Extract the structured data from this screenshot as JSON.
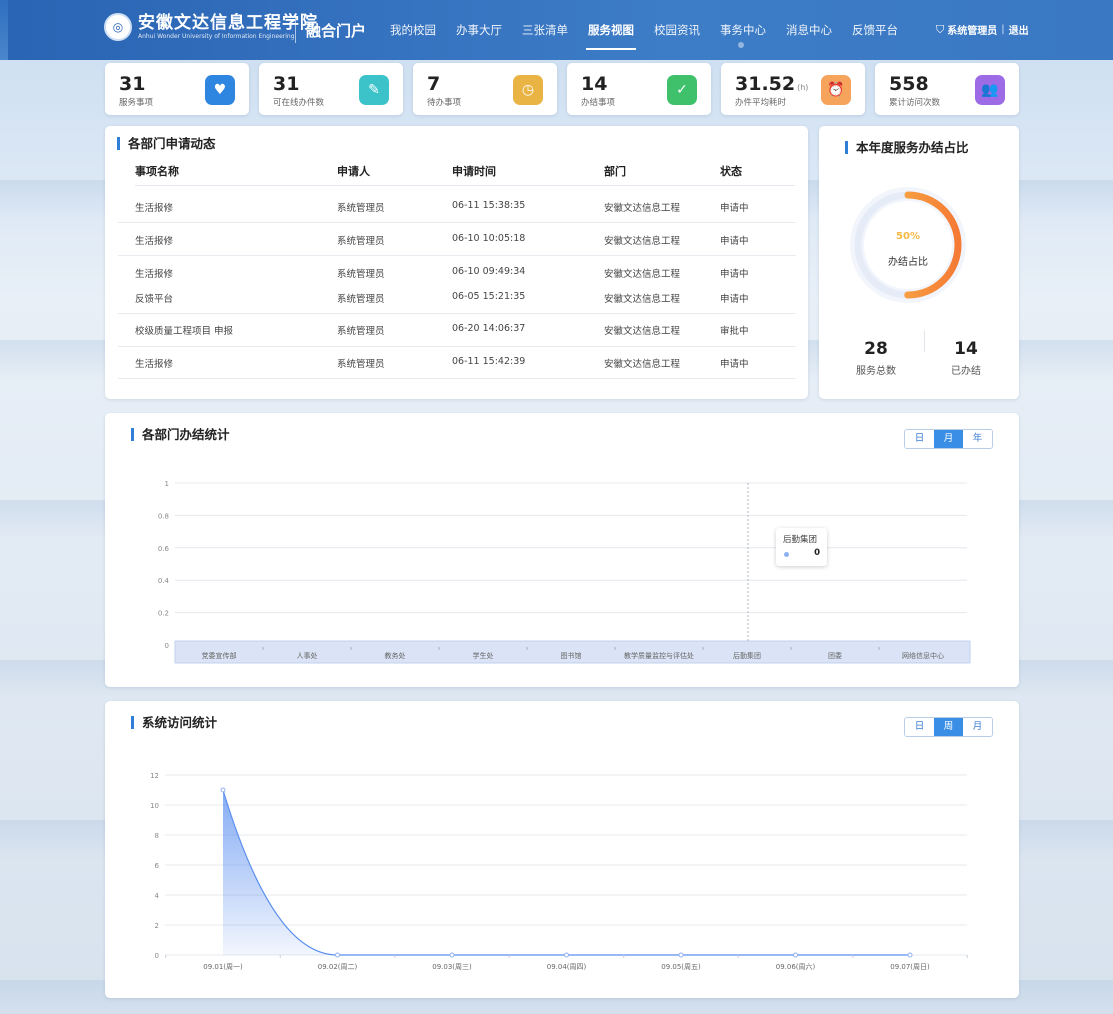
{
  "header": {
    "logo_cn": "安徽文达信息工程学院",
    "logo_en": "Anhui Wonder University of Information Engineering",
    "portal_title": "融合门户",
    "nav": [
      "我的校园",
      "办事大厅",
      "三张清单",
      "服务视图",
      "校园资讯",
      "事务中心",
      "消息中心",
      "反馈平台"
    ],
    "active_nav": "服务视图",
    "user": "系统管理员",
    "separator": "|",
    "logout": "退出"
  },
  "stats": [
    {
      "value": "31",
      "unit": "",
      "label": "服务事项",
      "icon": "heart-hand-icon",
      "color": "#2f86e0"
    },
    {
      "value": "31",
      "unit": "",
      "label": "可在线办件数",
      "icon": "document-edit-icon",
      "color": "#3cc3c9"
    },
    {
      "value": "7",
      "unit": "",
      "label": "待办事项",
      "icon": "document-clock-icon",
      "color": "#eab445"
    },
    {
      "value": "14",
      "unit": "",
      "label": "办结事项",
      "icon": "document-check-icon",
      "color": "#3fc16c"
    },
    {
      "value": "31.52",
      "unit": "(h)",
      "label": "办件平均耗时",
      "icon": "alarm-clock-icon",
      "color": "#f6a35c"
    },
    {
      "value": "558",
      "unit": "",
      "label": "累计访问次数",
      "icon": "users-icon",
      "color": "#9e6be6"
    }
  ],
  "dept_apply": {
    "title": "各部门申请动态",
    "columns": [
      "事项名称",
      "申请人",
      "申请时间",
      "部门",
      "状态"
    ],
    "rows": [
      [
        "生活报修",
        "系统管理员",
        "06-11 15:38:35",
        "安徽文达信息工程",
        "申请中"
      ],
      [
        "生活报修",
        "系统管理员",
        "06-10 10:05:18",
        "安徽文达信息工程",
        "申请中"
      ],
      [
        "生活报修",
        "系统管理员",
        "06-10 09:49:34",
        "安徽文达信息工程",
        "申请中"
      ],
      [
        "反馈平台",
        "系统管理员",
        "06-05 15:21:35",
        "安徽文达信息工程",
        "申请中"
      ],
      [
        "校级质量工程项目 申报",
        "系统管理员",
        "06-20 14:06:37",
        "安徽文达信息工程",
        "审批中"
      ],
      [
        "生活报修",
        "系统管理员",
        "06-11 15:42:39",
        "安徽文达信息工程",
        "申请中"
      ]
    ]
  },
  "completion": {
    "title": "本年度服务办结占比",
    "percent_text": "50%",
    "percent": 0.5,
    "center_label": "办结占比",
    "total_value": "28",
    "total_label": "服务总数",
    "done_value": "14",
    "done_label": "已办结"
  },
  "dept_stats": {
    "title": "各部门办结统计",
    "toggle": [
      "日",
      "月",
      "年"
    ],
    "toggle_active": "月",
    "tooltip": {
      "name": "后勤集团",
      "value": "0"
    }
  },
  "visit_stats": {
    "title": "系统访问统计",
    "toggle": [
      "日",
      "周",
      "月"
    ],
    "toggle_active": "周"
  },
  "chart_data": [
    {
      "type": "bar",
      "title": "各部门办结统计",
      "categories": [
        "党委宣传部",
        "人事处",
        "教务处",
        "学生处",
        "图书馆",
        "教学质量监控与评估处",
        "后勤集团",
        "团委",
        "网络信息中心"
      ],
      "values": [
        0,
        0,
        0,
        0,
        0,
        0,
        0,
        0,
        0
      ],
      "yticks": [
        "0",
        "0.2",
        "0.4",
        "0.6",
        "0.8",
        "1"
      ],
      "ylim": [
        0,
        1
      ],
      "grid": true,
      "highlight_category": "后勤集团"
    },
    {
      "type": "area",
      "title": "系统访问统计",
      "categories": [
        "09.01(周一)",
        "09.02(周二)",
        "09.03(周三)",
        "09.04(周四)",
        "09.05(周五)",
        "09.06(周六)",
        "09.07(周日)"
      ],
      "values": [
        11,
        0,
        0,
        0,
        0,
        0,
        0
      ],
      "yticks": [
        "0",
        "2",
        "4",
        "6",
        "8",
        "10",
        "12"
      ],
      "ylim": [
        0,
        12
      ],
      "grid": true,
      "smooth": true,
      "color": "#5b8ff0"
    }
  ]
}
